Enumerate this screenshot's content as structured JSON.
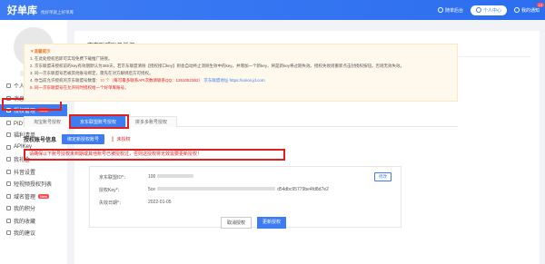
{
  "header": {
    "logo": "好单库",
    "slogan": "找好单就上好单库",
    "links": [
      {
        "label": "随单后台"
      },
      {
        "label": "个人中心"
      },
      {
        "label": "我的通知",
        "badge": "13"
      }
    ]
  },
  "sidebar": {
    "items": [
      {
        "label": "个人资料",
        "icon": "user-icon"
      },
      {
        "label": "消息通知",
        "icon": "message-icon",
        "tag": "13"
      },
      {
        "label": "授权管理",
        "icon": "key-icon",
        "tag": "New",
        "active": true
      },
      {
        "label": "PID设置",
        "icon": "settings-icon"
      },
      {
        "label": "福利清单",
        "icon": "gift-icon"
      },
      {
        "label": "APIKey",
        "icon": "api-icon"
      },
      {
        "label": "我礼金",
        "icon": "coin-icon"
      },
      {
        "label": "抖音设置",
        "icon": "video-icon"
      },
      {
        "label": "短视频授权列表",
        "icon": "list-icon"
      },
      {
        "label": "域名管理",
        "icon": "domain-icon",
        "tag": "New"
      },
      {
        "label": "我的积分",
        "icon": "points-icon"
      },
      {
        "label": "我的收藏",
        "icon": "star-icon"
      },
      {
        "label": "我的建议",
        "icon": "feedback-icon"
      }
    ]
  },
  "main": {
    "title": "京东联盟账号授权",
    "notice": {
      "title": "▼温馨提示",
      "lines": [
        "1. 在此处授权后即可实现免费下载推广链接。",
        "2. 京东联盟未授权前的key有效期默认为365天，若京东联盟清除【授权接口key】则会自动终止消除生效中的key，并增加一个新key，将是新key将过期失效。授权失败则重新点击封授权按钮，否则无效失效。",
        "3. 同一京东联盟号若被其他账号绑定，需先在对方解绑后方可授权。",
        "4. 你当前允许授权的京东联盟号数量：30 个（每可最多联系API次数请联系QQ：1261052362）  京东联盟地址 https://union.jd.com",
        "5. 同一京东联盟号在允许同时授权给一个好单库账号。"
      ],
      "highlight_count": "30 个",
      "qq_note": "（每可最多联系API次数请联系QQ：1261052362）",
      "union_label": "京东联盟地址",
      "union_url": "https://union.jd.com"
    },
    "tabs": [
      {
        "label": "淘宝账号授权"
      },
      {
        "label": "京东联盟账号授权",
        "active": true
      },
      {
        "label": "拼多多账号授权"
      }
    ],
    "auth": {
      "title": "授权账号信息",
      "bind_button": "绑定新授权账号",
      "status": "❗ 未授权",
      "warning": "请确保以下账号授权未到期或其他账号已被授权过，否则这授权将无效需要更新授权！",
      "rows": [
        {
          "key": "京东联盟ID*：",
          "value": "100"
        },
        {
          "key": "授权Key*：",
          "value": "5ce",
          "tail": "d54dbc95779be4fd8d7e2"
        },
        {
          "key": "失效日期*：",
          "value": "2022-01-05"
        }
      ],
      "edit_button": "修改",
      "cancel_button": "取消授权",
      "update_button": "更新授权"
    }
  }
}
